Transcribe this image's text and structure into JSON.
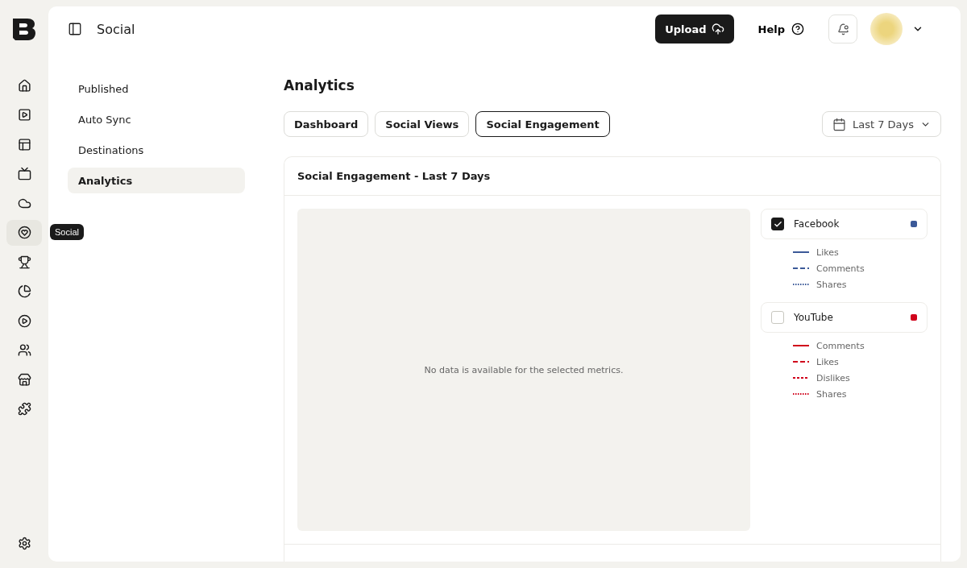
{
  "rail": {
    "items": [
      {
        "selected": false
      },
      {
        "selected": false
      },
      {
        "selected": false
      },
      {
        "selected": false
      },
      {
        "selected": false
      },
      {
        "selected": true
      },
      {
        "selected": false
      },
      {
        "selected": false
      },
      {
        "selected": false
      },
      {
        "selected": false
      },
      {
        "selected": false
      },
      {
        "selected": false
      }
    ],
    "tooltip": "Social"
  },
  "header": {
    "title": "Social",
    "upload": "Upload",
    "help": "Help"
  },
  "subnav": [
    {
      "label": "Published",
      "selected": false
    },
    {
      "label": "Auto Sync",
      "selected": false
    },
    {
      "label": "Destinations",
      "selected": false
    },
    {
      "label": "Analytics",
      "selected": true
    }
  ],
  "page_title": "Analytics",
  "tabs": [
    {
      "label": "Dashboard",
      "selected": false
    },
    {
      "label": "Social Views",
      "selected": false
    },
    {
      "label": "Social Engagement",
      "selected": true
    }
  ],
  "date_range": "Last 7 Days",
  "card": {
    "title": "Social Engagement - Last 7 Days",
    "empty_message": "No data is available for the selected metrics."
  },
  "platforms": [
    {
      "name": "Facebook",
      "checked": true,
      "color": "#3b5998",
      "metrics": [
        {
          "label": "Likes",
          "kind": "solid"
        },
        {
          "label": "Comments",
          "kind": "dashed"
        },
        {
          "label": "Shares",
          "kind": "dotted"
        }
      ]
    },
    {
      "name": "YouTube",
      "checked": false,
      "color": "#d0021b",
      "metrics": [
        {
          "label": "Comments",
          "kind": "solid"
        },
        {
          "label": "Likes",
          "kind": "dashed"
        },
        {
          "label": "Dislikes",
          "kind": "short"
        },
        {
          "label": "Shares",
          "kind": "dotted"
        }
      ]
    }
  ]
}
